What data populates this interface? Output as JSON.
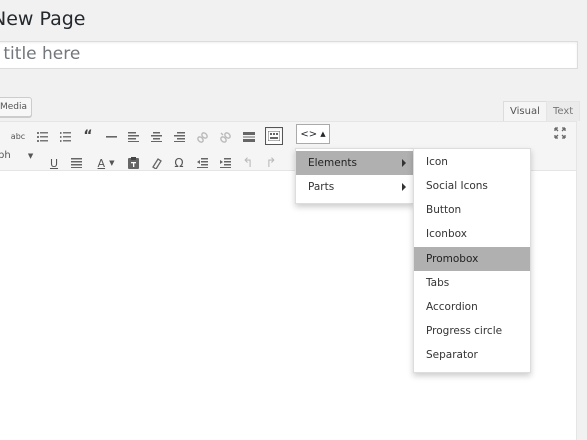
{
  "header": {
    "title": "New Page"
  },
  "title_field": {
    "placeholder_visible": "r title here"
  },
  "media": {
    "label": "Media"
  },
  "tabs": {
    "visual": "Visual",
    "text": "Text"
  },
  "format": {
    "label": "ph"
  },
  "menus": {
    "main": [
      {
        "label": "Elements",
        "highlight": true
      },
      {
        "label": "Parts",
        "highlight": false
      }
    ],
    "sub": [
      {
        "label": "Icon"
      },
      {
        "label": "Social Icons"
      },
      {
        "label": "Button"
      },
      {
        "label": "Iconbox"
      },
      {
        "label": "Promobox",
        "highlight": true
      },
      {
        "label": "Tabs"
      },
      {
        "label": "Accordion"
      },
      {
        "label": "Progress circle"
      },
      {
        "label": "Separator"
      }
    ]
  },
  "icons": {
    "row1": [
      "strikethrough-icon",
      "bullet-list-icon",
      "numbered-list-icon",
      "blockquote-icon",
      "horizontal-rule-icon",
      "align-left-icon",
      "align-center-icon",
      "align-right-icon",
      "link-icon",
      "unlink-icon",
      "read-more-icon",
      "toolbar-toggle-icon"
    ],
    "row2": [
      "underline-icon",
      "justify-icon",
      "text-color-icon",
      "paste-text-icon",
      "clear-format-icon",
      "special-char-icon",
      "outdent-icon",
      "indent-icon",
      "undo-icon",
      "redo-icon"
    ]
  }
}
